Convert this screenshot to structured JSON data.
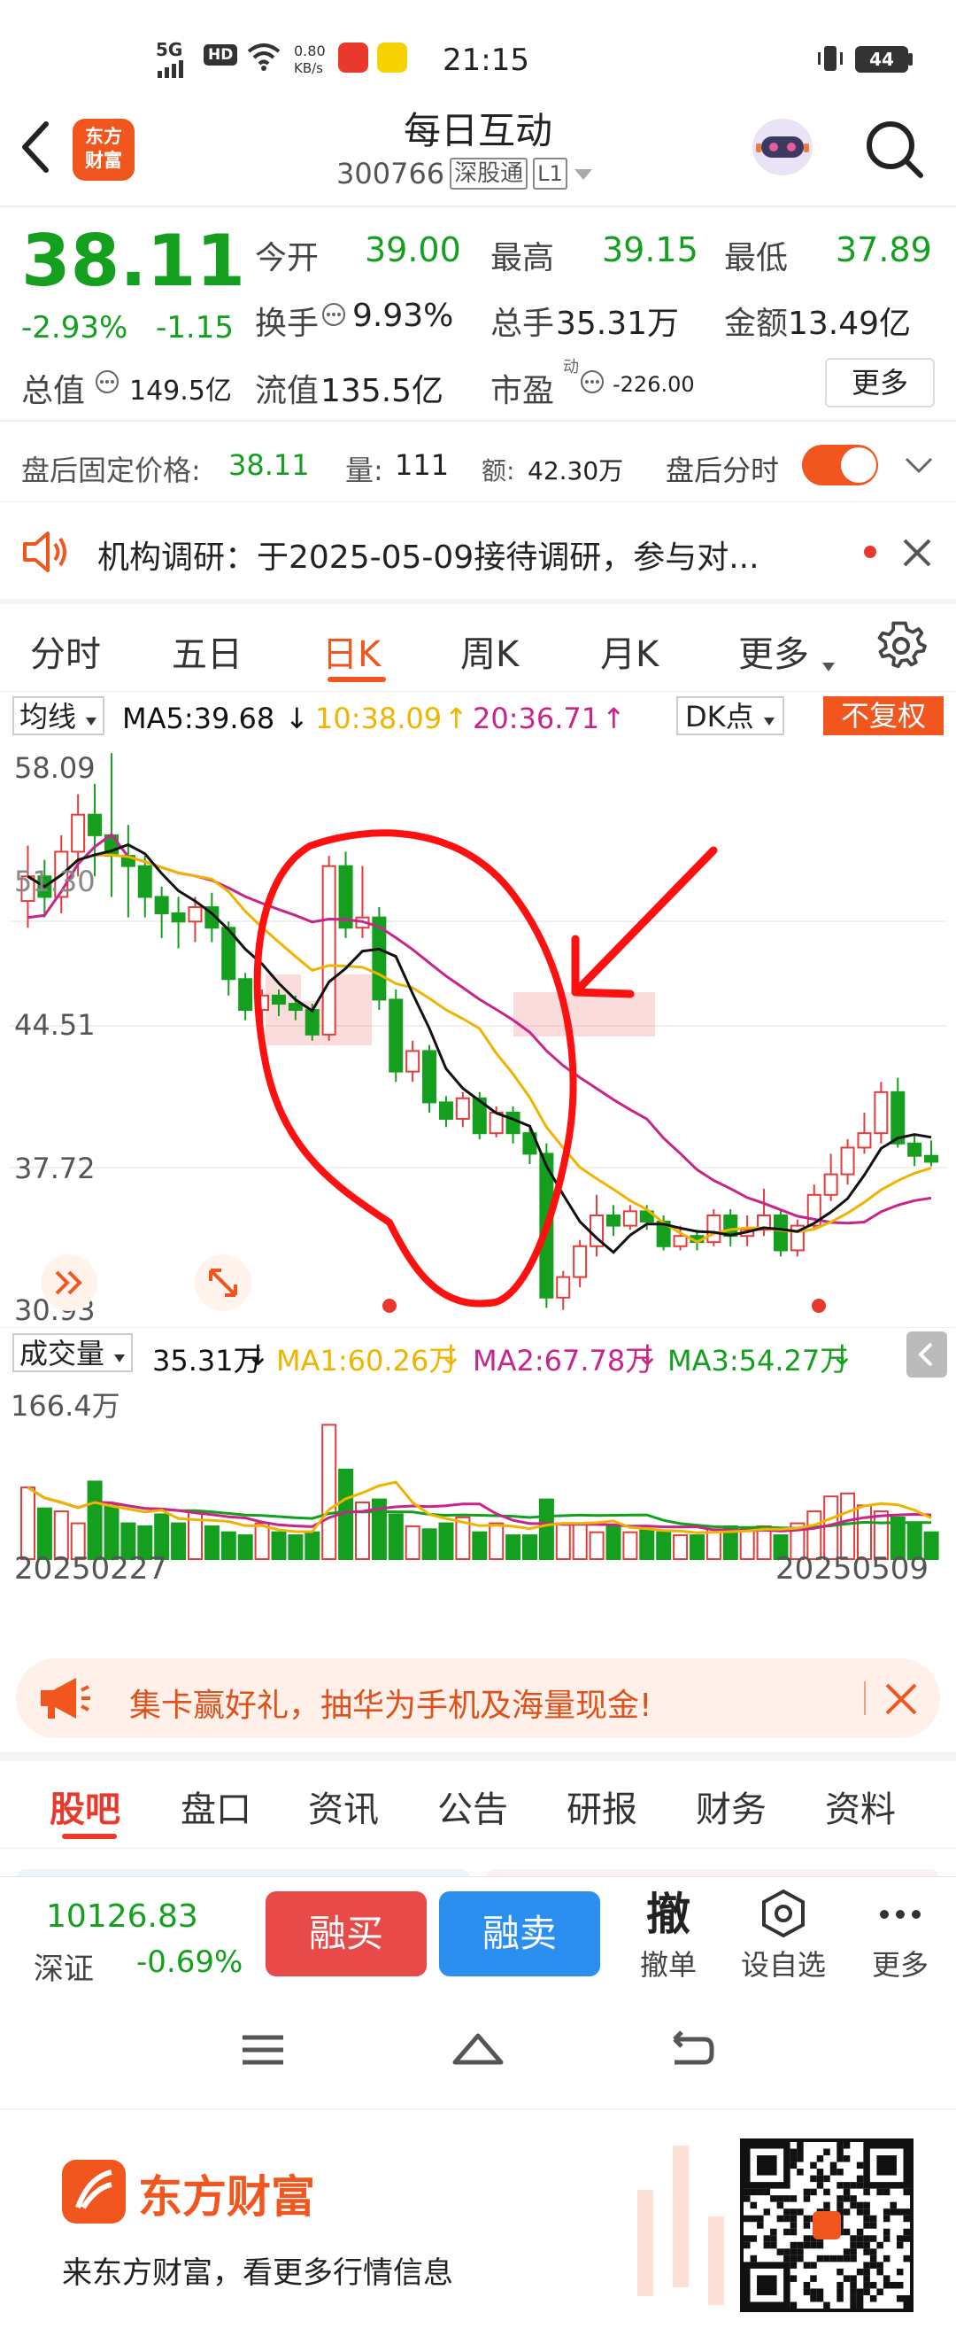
{
  "status_bar": {
    "network": "5G",
    "hd": "HD",
    "speed_val": "0.80",
    "speed_unit": "KB/s",
    "time": "21:15",
    "battery": "44"
  },
  "header": {
    "logo_top": "东方",
    "logo_bottom": "财富",
    "title": "每日互动",
    "code": "300766",
    "channel": "深股通",
    "level": "L1"
  },
  "quote": {
    "price": "38.11",
    "change_pct": "-2.93%",
    "change": "-1.15",
    "open_label": "今开",
    "open": "39.00",
    "high_label": "最高",
    "high": "39.15",
    "low_label": "最低",
    "low": "37.89",
    "turnover_label": "换手",
    "turnover": "9.93%",
    "volume_label": "总手",
    "volume": "35.31万",
    "amount_label": "金额",
    "amount": "13.49亿",
    "mktcap_label": "总值",
    "mktcap": "149.5亿",
    "float_label": "流值",
    "float": "135.5亿",
    "pe_label": "市盈",
    "pe_sup": "动",
    "pe": "-226.00",
    "more": "更多"
  },
  "after_hours": {
    "price_label": "盘后固定价格:",
    "price": "38.11",
    "vol_label": "量:",
    "vol": "111",
    "amt_label": "额:",
    "amt": "42.30万",
    "timeshare_label": "盘后分时"
  },
  "notice": {
    "text": "机构调研：于2025-05-09接待调研，参与对..."
  },
  "chart_tabs": [
    {
      "label": "分时"
    },
    {
      "label": "五日"
    },
    {
      "label": "日K"
    },
    {
      "label": "周K"
    },
    {
      "label": "月K"
    },
    {
      "label": "更多"
    }
  ],
  "kline": {
    "indicator": "均线",
    "ma5": "MA5:39.68",
    "ma10": "10:38.09",
    "ma20": "20:36.71",
    "dk": "DK点",
    "fq": "不复权",
    "y_labels": [
      "58.09",
      "51.30",
      "44.51",
      "37.72",
      "30.93"
    ],
    "colors": {
      "up": "#e33c3c",
      "down": "#14a01e",
      "ma5": "#111111",
      "ma10": "#f0b400",
      "ma20": "#c8248c"
    }
  },
  "volume": {
    "indicator": "成交量",
    "vol": "35.31万",
    "ma1": "MA1:60.26万",
    "ma2": "MA2:67.78万",
    "ma3": "MA3:54.27万",
    "max_label": "166.4万",
    "start_date": "20250227",
    "end_date": "20250509"
  },
  "promo": {
    "text": "集卡赢好礼，抽华为手机及海量现金!"
  },
  "content_tabs": [
    {
      "label": "股吧"
    },
    {
      "label": "盘口"
    },
    {
      "label": "资讯"
    },
    {
      "label": "公告"
    },
    {
      "label": "研报"
    },
    {
      "label": "财务"
    },
    {
      "label": "资料"
    }
  ],
  "bottom_bar": {
    "index_value": "10126.83",
    "index_name": "深证",
    "index_change": "-0.69%",
    "buy": "融买",
    "sell": "融卖",
    "cancel_glyph": "撤",
    "cancel": "撤单",
    "watch": "设自选",
    "more": "更多"
  },
  "footer": {
    "brand": "东方财富",
    "slogan": "来东方财富，看更多行情信息"
  }
}
